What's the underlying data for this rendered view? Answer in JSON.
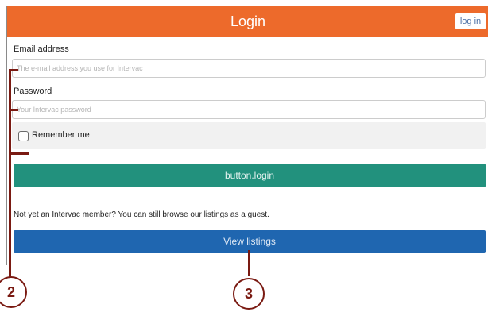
{
  "header": {
    "title": "Login",
    "login_button": "log in"
  },
  "form": {
    "email_label": "Email address",
    "email_placeholder": "The e-mail address you use for Intervac",
    "password_label": "Password",
    "password_placeholder": "Your Intervac password",
    "remember_label": "Remember me",
    "remember_checked": false,
    "login_button": "button.login"
  },
  "guest": {
    "text": "Not yet an Intervac member? You can still browse our listings as a guest.",
    "view_button": "View listings"
  },
  "callouts": {
    "left": "2",
    "right": "3"
  },
  "colors": {
    "header": "#ed6a2b",
    "login_button": "#22917d",
    "view_button": "#1f66b0",
    "callout": "#7a1a12"
  },
  "icons": {
    "remember_checkbox": "checkbox-unchecked-icon"
  }
}
